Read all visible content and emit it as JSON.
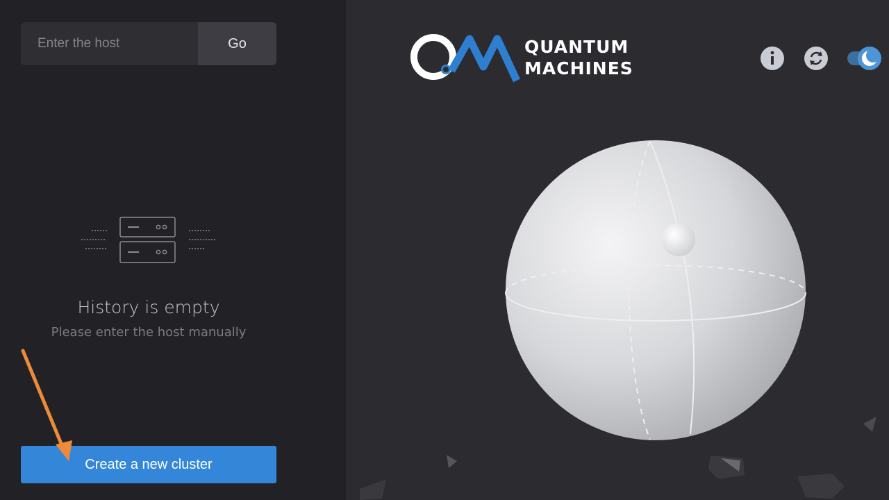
{
  "host": {
    "placeholder": "Enter the host",
    "value": "",
    "go_label": "Go"
  },
  "history": {
    "title": "History is empty",
    "subtitle": "Please enter the host manually"
  },
  "actions": {
    "create_cluster_label": "Create a new cluster"
  },
  "brand": {
    "line1": "QUANTUM",
    "line2": "MACHINES",
    "colors": {
      "blue": "#2f7fd0",
      "white": "#ffffff"
    }
  },
  "toolbar": {
    "icons": [
      "info-icon",
      "refresh-icon",
      "dark-mode-toggle"
    ]
  },
  "theme": {
    "sidebar_bg": "#222226",
    "main_bg": "#2b2b30",
    "accent": "#3487d8",
    "annotation_arrow": "#ef8a3a"
  }
}
